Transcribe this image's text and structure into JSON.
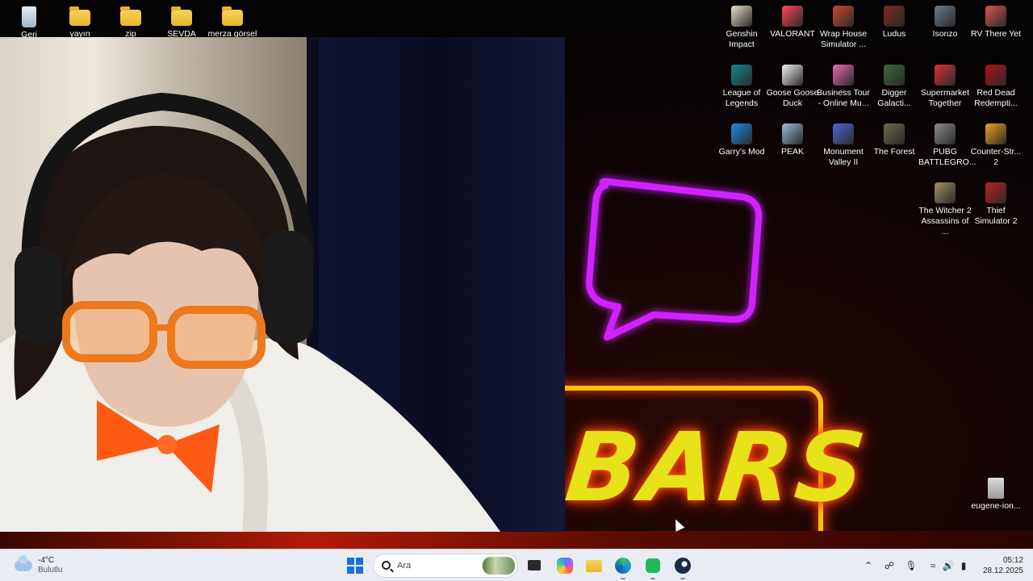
{
  "desktop_left": [
    {
      "label": "Geri",
      "icon": "recycle-bin-icon"
    },
    {
      "label": "yayın",
      "icon": "folder-icon"
    },
    {
      "label": "zip",
      "icon": "folder-icon"
    },
    {
      "label": "SEVDA",
      "icon": "folder-icon"
    },
    {
      "label": "merza görsel",
      "icon": "folder-icon"
    }
  ],
  "desktop_right": [
    {
      "label": "Genshin Impact",
      "icon": "genshin-impact-icon",
      "color": "#e8dcc8"
    },
    {
      "label": "VALORANT",
      "icon": "valorant-icon",
      "color": "#ff4655"
    },
    {
      "label": "Wrap House Simulator ...",
      "icon": "wrap-house-icon",
      "color": "#c94a2c"
    },
    {
      "label": "Ludus",
      "icon": "ludus-icon",
      "color": "#7a2a1a"
    },
    {
      "label": "Isonzo",
      "icon": "isonzo-icon",
      "color": "#6a7a8a"
    },
    {
      "label": "RV There Yet",
      "icon": "rv-there-yet-icon",
      "color": "#d9534f"
    },
    {
      "label": "League of Legends",
      "icon": "league-of-legends-icon",
      "color": "#0a8a9a"
    },
    {
      "label": "Goose Goose Duck",
      "icon": "goose-goose-duck-icon",
      "color": "#f2f2f2"
    },
    {
      "label": "Business Tour - Online Mu...",
      "icon": "business-tour-icon",
      "color": "#e86ab0"
    },
    {
      "label": "Digger Galacti...",
      "icon": "digger-galactic-icon",
      "color": "#3a6a3a"
    },
    {
      "label": "Supermarket Together",
      "icon": "supermarket-together-icon",
      "color": "#e03030"
    },
    {
      "label": "Red Dead Redempti...",
      "icon": "red-dead-redemption-icon",
      "color": "#b01010"
    },
    {
      "label": "Garry's Mod",
      "icon": "garrys-mod-icon",
      "color": "#1e88e5"
    },
    {
      "label": "PEAK",
      "icon": "peak-icon",
      "color": "#9ab8d8"
    },
    {
      "label": "Monument Valley II",
      "icon": "monument-valley-icon",
      "color": "#4a6ad8"
    },
    {
      "label": "The Forest",
      "icon": "the-forest-icon",
      "color": "#6a6a4a"
    },
    {
      "label": "PUBG BATTLEGRO...",
      "icon": "pubg-icon",
      "color": "#8a8a8a"
    },
    {
      "label": "Counter-Str... 2",
      "icon": "counter-strike-icon",
      "color": "#f0a020"
    },
    {
      "label": "The Witcher 2 Assassins of ...",
      "icon": "witcher-2-icon",
      "color": "#a09060"
    },
    {
      "label": "Thief Simulator 2",
      "icon": "thief-simulator-icon",
      "color": "#c02020"
    }
  ],
  "desktop_file": {
    "label": "eugene-ion...",
    "icon": "file-icon"
  },
  "wallpaper": {
    "sign_text": "BARS",
    "neon_pink": "#d020ff",
    "neon_yellow": "#e7e21a"
  },
  "taskbar": {
    "weather": {
      "temp": "-4°C",
      "condition": "Bulutlu"
    },
    "search_placeholder": "Ara",
    "apps": [
      "task-view-icon",
      "copilot-icon",
      "file-explorer-icon",
      "edge-icon",
      "whatsapp-icon",
      "steam-icon"
    ]
  },
  "clock": {
    "time": "05:12",
    "date": "28.12.2025"
  }
}
